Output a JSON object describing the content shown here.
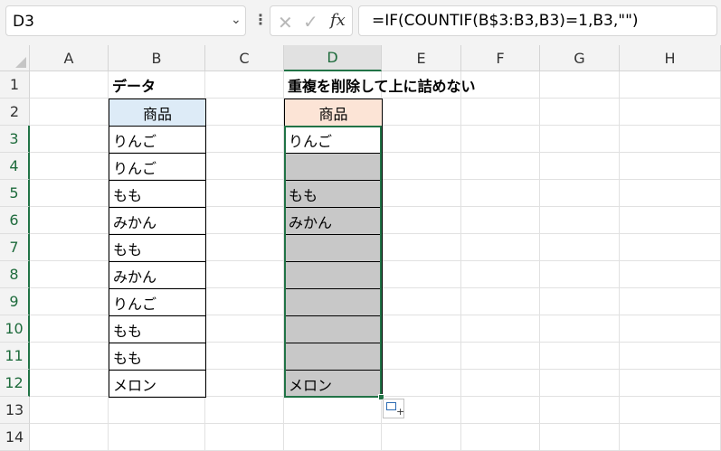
{
  "formula_bar": {
    "name_box": "D3",
    "formula": "=IF(COUNTIF(B$3:B3,B3)=1,B3,\"\")",
    "fx_label": "fx"
  },
  "columns": [
    "A",
    "B",
    "C",
    "D",
    "E",
    "F",
    "G",
    "H"
  ],
  "rows": [
    "1",
    "2",
    "3",
    "4",
    "5",
    "6",
    "7",
    "8",
    "9",
    "10",
    "11",
    "12",
    "13",
    "14"
  ],
  "cells": {
    "B1": "データ",
    "D1": "重複を削除して上に詰めない",
    "B2": "商品",
    "D2": "商品",
    "B": [
      "りんご",
      "りんご",
      "もも",
      "みかん",
      "もも",
      "みかん",
      "りんご",
      "もも",
      "もも",
      "メロン"
    ],
    "D": [
      "りんご",
      "",
      "もも",
      "みかん",
      "",
      "",
      "",
      "",
      "",
      "メロン"
    ]
  },
  "colors": {
    "accent": "#217346",
    "header_b_fill": "#ddebf7",
    "header_d_fill": "#fce4d6",
    "blank_result_fill": "#c8c8c8"
  },
  "icons": {
    "cancel": "close-icon",
    "enter": "check-icon",
    "function": "fx-icon",
    "name_box_dropdown": "chevron-down-icon",
    "quick_analysis": "quick-analysis-icon"
  }
}
